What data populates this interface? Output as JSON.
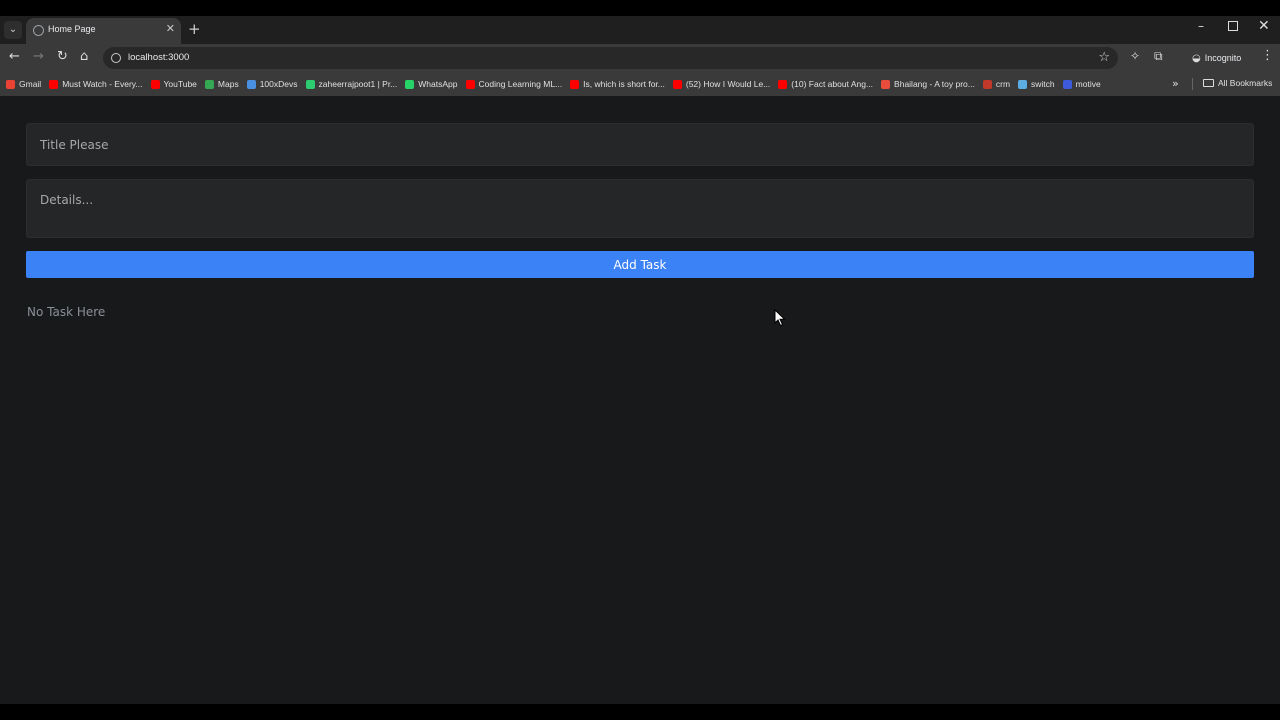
{
  "browser": {
    "tab": {
      "title": "Home Page",
      "favicon": "globe-icon"
    },
    "address_bar": {
      "url": "localhost:3000"
    },
    "profile_label": "Incognito",
    "bookmarks": [
      {
        "label": "Gmail",
        "icon": "gmail-icon",
        "color": "#ea4335"
      },
      {
        "label": "Must Watch - Every...",
        "icon": "youtube-icon",
        "color": "#ff0000"
      },
      {
        "label": "YouTube",
        "icon": "youtube-icon",
        "color": "#ff0000"
      },
      {
        "label": "Maps",
        "icon": "maps-icon",
        "color": "#34a853"
      },
      {
        "label": "100xDevs",
        "icon": "devs-icon",
        "color": "#4a90e2"
      },
      {
        "label": "zaheerrajpoot1 | Pr...",
        "icon": "profile-icon",
        "color": "#2ecc71"
      },
      {
        "label": "WhatsApp",
        "icon": "whatsapp-icon",
        "color": "#25d366"
      },
      {
        "label": "Coding Learning ML...",
        "icon": "youtube-icon",
        "color": "#ff0000"
      },
      {
        "label": "Is, which is short for...",
        "icon": "youtube-icon",
        "color": "#ff0000"
      },
      {
        "label": "(52) How I Would Le...",
        "icon": "youtube-icon",
        "color": "#ff0000"
      },
      {
        "label": "(10) Fact about Ang...",
        "icon": "youtube-icon",
        "color": "#ff0000"
      },
      {
        "label": "Bhailang - A toy pro...",
        "icon": "bhailang-icon",
        "color": "#e74c3c"
      },
      {
        "label": "crm",
        "icon": "crm-icon",
        "color": "#c0392b"
      },
      {
        "label": "switch",
        "icon": "switch-icon",
        "color": "#5dade2"
      },
      {
        "label": "motive",
        "icon": "motive-icon",
        "color": "#3b5bdb"
      }
    ],
    "all_bookmarks_label": "All Bookmarks"
  },
  "page": {
    "title_placeholder": "Title Please",
    "details_placeholder": "Details...",
    "add_button_label": "Add Task",
    "empty_message": "No Task Here",
    "accent_color": "#3b82f6"
  }
}
